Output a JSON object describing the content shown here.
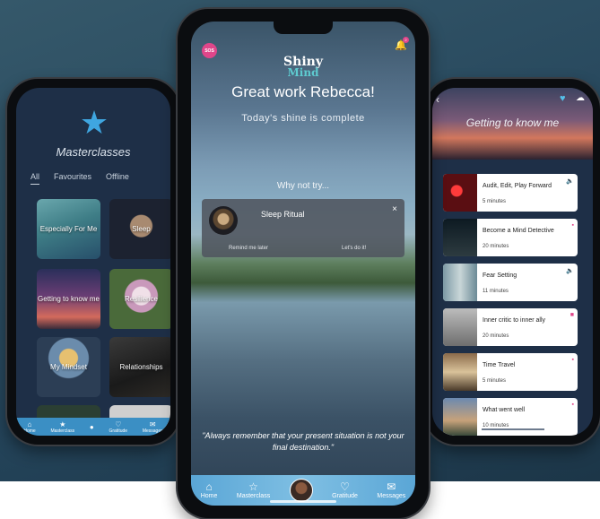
{
  "left": {
    "title": "Masterclasses",
    "tabs": [
      "All",
      "Favourites",
      "Offline"
    ],
    "tiles": [
      "Especially For Me",
      "Sleep",
      "Getting to know me",
      "Resilience",
      "My Mindset",
      "Relationships"
    ],
    "nav": [
      "Home",
      "Masterclass",
      "",
      "Gratitude",
      "Messages"
    ]
  },
  "center": {
    "sos": "SOS",
    "notification_count": "2",
    "logo_line1": "Shiny",
    "logo_line2": "Mind",
    "greeting": "Great work Rebecca!",
    "subtext": "Today's shine is complete",
    "why_not": "Why not try...",
    "card": {
      "title": "Sleep Ritual",
      "close": "×",
      "remind": "Remind me later",
      "do": "Let's do it!"
    },
    "quote": "\"Always remember that your present situation is not your final destination.\"",
    "nav": {
      "home": "Home",
      "masterclass": "Masterclass",
      "gratitude": "Gratitude",
      "messages": "Messages"
    }
  },
  "right": {
    "title": "Getting to know me",
    "episodes": [
      {
        "title": "Audit, Edit, Play Forward",
        "duration": "5 minutes",
        "badge": "🔈"
      },
      {
        "title": "Become a Mind Detective",
        "duration": "20 minutes",
        "badge": "▪"
      },
      {
        "title": "Fear Setting",
        "duration": "11 minutes",
        "badge": "🔈"
      },
      {
        "title": "Inner critic to inner ally",
        "duration": "20 minutes",
        "badge": "■"
      },
      {
        "title": "Time Travel",
        "duration": "5 minutes",
        "badge": "▪"
      },
      {
        "title": "What went well",
        "duration": "10 minutes",
        "badge": "▪"
      }
    ]
  },
  "colors": {
    "accent_blue": "#3fa6e0",
    "pink": "#e0468a",
    "teal_logo": "#5ecbd0",
    "dark_panel": "#1e2f47"
  }
}
